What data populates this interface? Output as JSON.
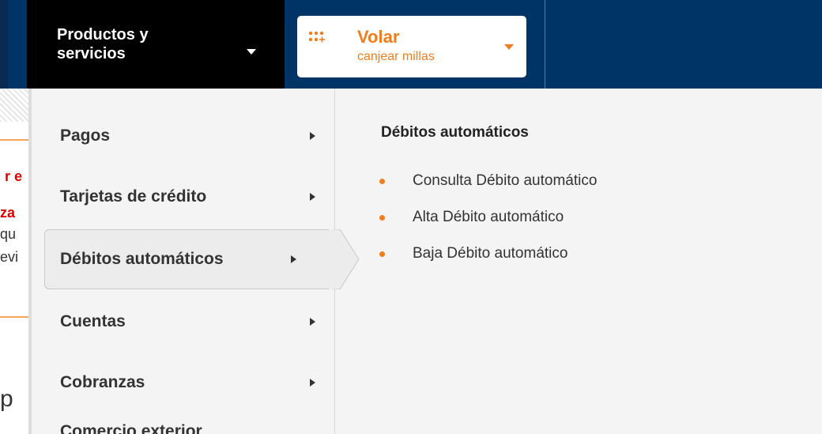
{
  "topbar": {
    "products_label": "Productos y\nservicios",
    "volar": {
      "title": "Volar",
      "subtitle": "canjear millas"
    }
  },
  "menu": {
    "items": [
      {
        "label": "Pagos"
      },
      {
        "label": "Tarjetas de crédito"
      },
      {
        "label": "Débitos automáticos",
        "active": true
      },
      {
        "label": "Cuentas"
      },
      {
        "label": "Cobranzas"
      }
    ],
    "partial_item": "Comercio exterior"
  },
  "submenu": {
    "heading": "Débitos automáticos",
    "items": [
      {
        "label": "Consulta Débito automático"
      },
      {
        "label": "Alta Débito automático"
      },
      {
        "label": "Baja Débito automático"
      }
    ]
  },
  "background_text": [
    "r e",
    "za",
    "qu",
    "evi",
    "p"
  ],
  "colors": {
    "accent_orange": "#f07e1e",
    "nav_blue": "#003366",
    "menu_bg": "#f4f4f4"
  }
}
